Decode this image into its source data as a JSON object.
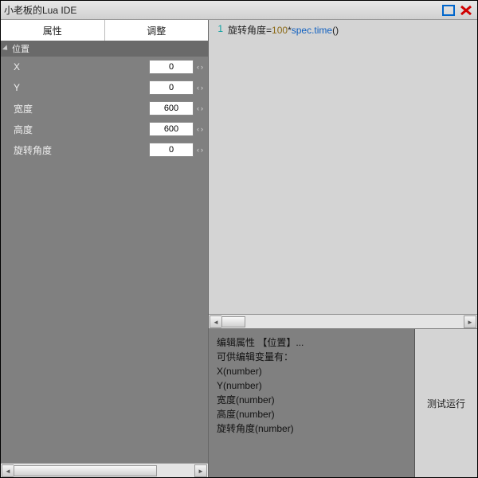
{
  "window": {
    "title": "小老板的Lua IDE"
  },
  "tabs": {
    "attr": "属性",
    "adjust": "调整"
  },
  "group": {
    "position": "位置"
  },
  "props": {
    "x": {
      "label": "X",
      "value": "0"
    },
    "y": {
      "label": "Y",
      "value": "0"
    },
    "width": {
      "label": "宽度",
      "value": "600"
    },
    "height": {
      "label": "高度",
      "value": "600"
    },
    "rotation": {
      "label": "旋转角度",
      "value": "0"
    }
  },
  "editor": {
    "line1_num": "1",
    "seg_var": "旋转角度",
    "seg_eq": "=",
    "seg_hundred": "100",
    "seg_star": "*",
    "seg_api": "spec.time",
    "seg_paren": "()"
  },
  "info": {
    "l1": "编辑属性 【位置】...",
    "l2": "可供编辑变量有：",
    "l3": "X(number)",
    "l4": "Y(number)",
    "l5": "宽度(number)",
    "l6": "高度(number)",
    "l7": "旋转角度(number)"
  },
  "run_label": "测试运行"
}
